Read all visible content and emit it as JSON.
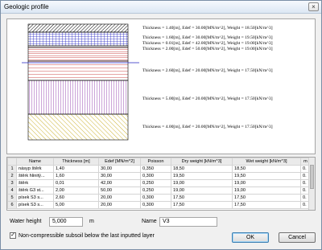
{
  "window": {
    "title": "Geologic profile",
    "close_symbol": "×"
  },
  "profile": {
    "captions": [
      "Thickness = 1.40[m], Edef = 30.00[MN/m^2], Weight = 18.50[kN/m^3]",
      "Thickness = 1.60[m], Edef = 30.00[MN/m^2], Weight = 19.50[kN/m^3]",
      "Thickness = 0.01[m], Edef = 42.00[MN/m^2], Weight = 19.00[kN/m^3]",
      "Thickness = 2.00[m], Edef = 50.00[MN/m^2], Weight = 19.00[kN/m^3]",
      "Thickness = 2.60[m], Edef = 20.00[MN/m^2], Weight = 17.50[kN/m^3]",
      "Thickness = 5.00[m], Edef = 20.00[MN/m^2], Weight = 17.50[kN/m^3]",
      "Thickness = 4.00[m], Edef = 20.00[MN/m^2], Weight = 17.50[kN/m^3]"
    ],
    "colors": {
      "layer1": "#000000",
      "layer2": "#2020c0",
      "layer3": "#c02020",
      "layer4": "#c02020",
      "layer5": "#c02020",
      "layer6": "#8020a0",
      "layer7": "#c0a000",
      "water_line": "#2020c0"
    }
  },
  "table": {
    "headers": [
      "",
      "Name",
      "Thickness [m]",
      "Edef [MN/m^2]",
      "Poisson",
      "Dry weight [kN/m^3]",
      "Wet weight [kN/m^3]",
      "m"
    ],
    "rows": [
      [
        "1",
        "násyp štěrk",
        "1,40",
        "30,00",
        "0,350",
        "18,50",
        "18,50",
        "0."
      ],
      [
        "2",
        "štěrk hlinitý...",
        "1,60",
        "30,00",
        "0,300",
        "19,50",
        "19,50",
        "0."
      ],
      [
        "3",
        "štěrk",
        "0,01",
        "42,00",
        "0,250",
        "19,00",
        "19,00",
        "0."
      ],
      [
        "4",
        "štěrk G3 st...",
        "2,00",
        "50,00",
        "0,250",
        "19,00",
        "19,00",
        "0."
      ],
      [
        "5",
        "písek S3 s...",
        "2,60",
        "20,00",
        "0,300",
        "17,50",
        "17,50",
        "0."
      ],
      [
        "6",
        "písek S3 s...",
        "5,00",
        "20,00",
        "0,300",
        "17,50",
        "17,50",
        "0."
      ]
    ]
  },
  "water_height": {
    "label": "Water height",
    "value": "5,000",
    "unit": "m"
  },
  "name_field": {
    "label": "Name",
    "value": "V3"
  },
  "checkbox": {
    "label": "Non-compressible subsoil below the last inputted layer",
    "checked": true,
    "mark": "✓"
  },
  "buttons": {
    "ok": "OK",
    "cancel": "Cancel"
  }
}
